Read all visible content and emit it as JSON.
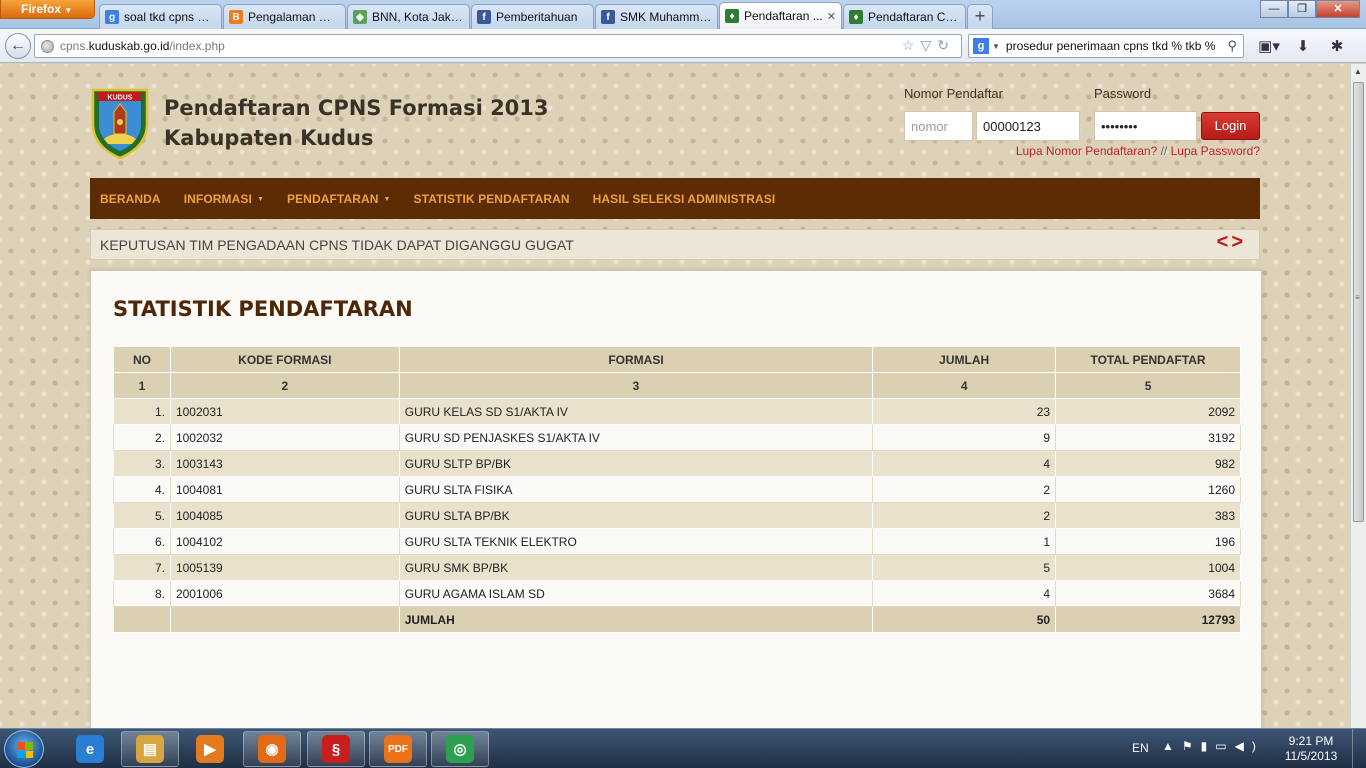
{
  "browser": {
    "menu_label": "Firefox",
    "tabs": [
      {
        "label": "soal tkd cpns 20...",
        "icon": "google-icon",
        "color": "#3d7ee8",
        "glyph": "g"
      },
      {
        "label": "Pengalaman Me...",
        "icon": "blogger-icon",
        "color": "#ef7d1e",
        "glyph": "B"
      },
      {
        "label": "BNN, Kota Jakar...",
        "icon": "maps-icon",
        "color": "#5aa25a",
        "glyph": "◆"
      },
      {
        "label": "Pemberitahuan",
        "icon": "facebook-icon",
        "color": "#3b5998",
        "glyph": "f"
      },
      {
        "label": "SMK Muhamma...",
        "icon": "facebook-icon",
        "color": "#3b5998",
        "glyph": "f"
      },
      {
        "label": "Pendaftaran ...",
        "icon": "kudus-crest-icon",
        "color": "#2e7d32",
        "glyph": "♦",
        "active": true
      },
      {
        "label": "Pendaftaran CP...",
        "icon": "kudus-crest-icon",
        "color": "#2e7d32",
        "glyph": "♦"
      }
    ],
    "url_prefix": "cpns.",
    "url_domain": "kuduskab.go.id",
    "url_path": "/index.php",
    "search_value": "prosedur penerimaan cpns tkd % tkb %"
  },
  "site": {
    "title_line1": "Pendaftaran CPNS Formasi 2013",
    "title_line2": "Kabupaten Kudus",
    "logo_text": "KUDUS"
  },
  "login": {
    "nomor_label": "Nomor Pendaftar",
    "password_label": "Password",
    "nomor_placeholder": "nomor",
    "nomor_value": "00000123",
    "password_value": "••••••••",
    "login_button": "Login",
    "forgot_nomor": "Lupa Nomor Pendaftaran?",
    "forgot_sep": " // ",
    "forgot_password": "Lupa Password?"
  },
  "nav": {
    "items": [
      {
        "label": "BERANDA"
      },
      {
        "label": "INFORMASI",
        "dropdown": true
      },
      {
        "label": "PENDAFTARAN",
        "dropdown": true
      },
      {
        "label": "STATISTIK PENDAFTARAN"
      },
      {
        "label": "HASIL SELEKSI ADMINISTRASI"
      }
    ]
  },
  "ticker": {
    "text": "KEPUTUSAN TIM PENGADAAN CPNS TIDAK DAPAT DIGANGGU GUGAT",
    "prev": "<",
    "next": ">"
  },
  "stats": {
    "heading": "STATISTIK PENDAFTARAN",
    "headers": [
      "NO",
      "KODE FORMASI",
      "FORMASI",
      "JUMLAH",
      "TOTAL PENDAFTAR"
    ],
    "col_numbers": [
      "1",
      "2",
      "3",
      "4",
      "5"
    ],
    "rows": [
      {
        "no": "1.",
        "kode": "1002031",
        "formasi": "GURU KELAS SD S1/AKTA IV",
        "jumlah": "23",
        "total": "2092"
      },
      {
        "no": "2.",
        "kode": "1002032",
        "formasi": "GURU SD PENJASKES S1/AKTA IV",
        "jumlah": "9",
        "total": "3192"
      },
      {
        "no": "3.",
        "kode": "1003143",
        "formasi": "GURU SLTP BP/BK",
        "jumlah": "4",
        "total": "982"
      },
      {
        "no": "4.",
        "kode": "1004081",
        "formasi": "GURU SLTA FISIKA",
        "jumlah": "2",
        "total": "1260"
      },
      {
        "no": "5.",
        "kode": "1004085",
        "formasi": "GURU SLTA BP/BK",
        "jumlah": "2",
        "total": "383"
      },
      {
        "no": "6.",
        "kode": "1004102",
        "formasi": "GURU SLTA TEKNIK ELEKTRO",
        "jumlah": "1",
        "total": "196"
      },
      {
        "no": "7.",
        "kode": "1005139",
        "formasi": "GURU SMK BP/BK",
        "jumlah": "5",
        "total": "1004"
      },
      {
        "no": "8.",
        "kode": "2001006",
        "formasi": "GURU AGAMA ISLAM SD",
        "jumlah": "4",
        "total": "3684"
      }
    ],
    "footer_label": "JUMLAH",
    "footer_jumlah": "50",
    "footer_total": "12793"
  },
  "taskbar": {
    "apps": [
      {
        "name": "ie-icon",
        "glyph": "e",
        "color": "#2a7fd4",
        "running": false
      },
      {
        "name": "file-explorer-icon",
        "glyph": "▤",
        "color": "#d8a640",
        "running": true
      },
      {
        "name": "media-player-icon",
        "glyph": "▶",
        "color": "#e27b1e",
        "running": false
      },
      {
        "name": "firefox-icon",
        "glyph": "◉",
        "color": "#e36b16",
        "running": true
      },
      {
        "name": "app-swirl-icon",
        "glyph": "§",
        "color": "#c81e1e",
        "running": true
      },
      {
        "name": "pdf-icon",
        "glyph": "PDF",
        "color": "#e8731a",
        "running": true
      },
      {
        "name": "chrome-icon",
        "glyph": "◎",
        "color": "#2e9e4f",
        "running": true
      }
    ],
    "language": "EN",
    "time": "9:21 PM",
    "date": "11/5/2013"
  }
}
